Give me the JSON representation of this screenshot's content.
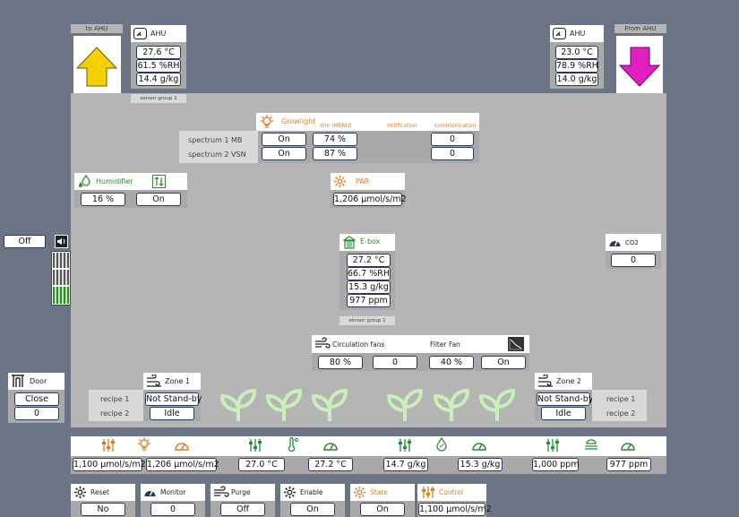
{
  "to_ahu": {
    "label": "to AHU"
  },
  "from_ahu": {
    "label": "From AHU"
  },
  "ahu_left": {
    "title": "AHU",
    "temp": "27.6 °C",
    "rh": "61.5 %RH",
    "abs": "14.4 g/kg",
    "sensor_group": "sensor group 2"
  },
  "ahu_right": {
    "title": "AHU",
    "temp": "23.0 °C",
    "rh": "78.9 %RH",
    "abs": "14.0 g/kg"
  },
  "growlight": {
    "title": "Growlight",
    "col_dim": "dim (MENU)",
    "col_notification": "notification",
    "col_communication": "communication",
    "rows": [
      {
        "label": "spectrum 1 MB",
        "state": "On",
        "dim": "74 %",
        "comm": "0"
      },
      {
        "label": "spectrum 2 VSN",
        "state": "On",
        "dim": "87 %",
        "comm": "0"
      }
    ]
  },
  "humidifier": {
    "title": "Humidifier",
    "value": "16 %",
    "state": "On"
  },
  "par": {
    "title": "PAR",
    "value": "1,206 µmol/s/m2"
  },
  "ebox": {
    "title": "E-box",
    "temp": "27.2 °C",
    "rh": "66.7 %RH",
    "abs": "15.3 g/kg",
    "co2": "977 ppm",
    "sensor_group": "sensor group 1"
  },
  "co2": {
    "title": "CO2",
    "value": "0"
  },
  "sound": {
    "state": "Off"
  },
  "fans": {
    "title": "Circulation fans",
    "filter_title": "Filter Fan",
    "circ_value": "80 %",
    "circ_second": "0",
    "filter_value": "40 %",
    "filter_state": "On"
  },
  "door": {
    "title": "Door",
    "state": "Close",
    "value": "0"
  },
  "zone1": {
    "title": "Zone 1",
    "standby": "Not Stand-by",
    "status": "Idle",
    "recipe1": "recipe 1",
    "recipe2": "recipe 2"
  },
  "zone2": {
    "title": "Zone 2",
    "standby": "Not Stand-by",
    "status": "Idle",
    "recipe1": "recipe 1",
    "recipe2": "recipe 2"
  },
  "bottom": {
    "light_setpoint": "1,100 µmol/s/m2",
    "light_actual": "1,206 µmol/s/m2",
    "temp_setpoint": "27.0 °C",
    "temp_actual": "27.2 °C",
    "hum_setpoint": "14.7 g/kg",
    "hum_actual": "15.3 g/kg",
    "co2_setpoint": "1,000 ppm",
    "co2_actual": "977 ppm"
  },
  "controls": {
    "reset": {
      "title": "Reset",
      "value": "No"
    },
    "monitor": {
      "title": "Monitor",
      "value": "0"
    },
    "purge": {
      "title": "Purge",
      "value": "Off"
    },
    "enable": {
      "title": "Enable",
      "value": "On"
    },
    "state": {
      "title": "State",
      "value": "On"
    },
    "control": {
      "title": "Control",
      "value": "1,100 µmol/s/m2"
    }
  },
  "colors": {
    "background": "#6b7585",
    "room": "#b5b5b5",
    "accent_green": "#2c8a32",
    "accent_orange": "#e07b1a",
    "arrow_up": "#f5d000",
    "arrow_down": "#e020c0",
    "plant": "#c8f0b8",
    "value_border": "#2a3a55"
  }
}
